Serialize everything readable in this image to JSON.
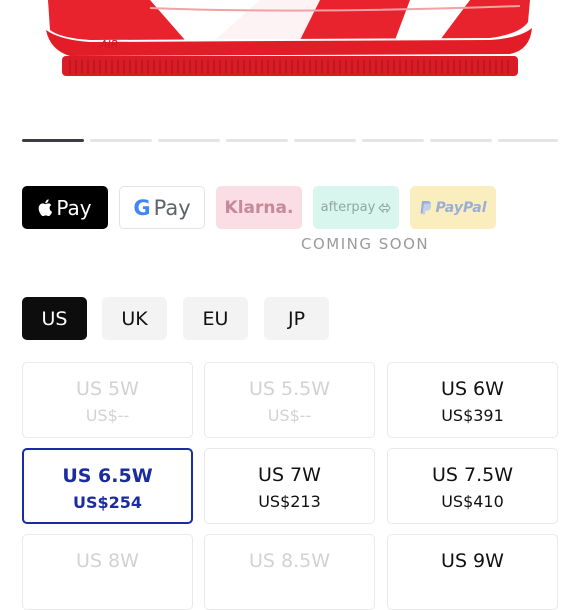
{
  "payment_methods": {
    "apple": "Pay",
    "google": "Pay",
    "klarna": "Klarna.",
    "afterpay": "afterpay",
    "paypal": "PayPal",
    "coming_soon": "COMING SOON"
  },
  "regions": [
    "US",
    "UK",
    "EU",
    "JP"
  ],
  "sizes": [
    {
      "label": "US 5W",
      "price": "US$--"
    },
    {
      "label": "US 5.5W",
      "price": "US$--"
    },
    {
      "label": "US 6W",
      "price": "US$391"
    },
    {
      "label": "US 6.5W",
      "price": "US$254"
    },
    {
      "label": "US 7W",
      "price": "US$213"
    },
    {
      "label": "US 7.5W",
      "price": "US$410"
    },
    {
      "label": "US 8W",
      "price": ""
    },
    {
      "label": "US 8.5W",
      "price": ""
    },
    {
      "label": "US 9W",
      "price": ""
    }
  ],
  "colors": {
    "selected": "#1a2ca0",
    "shoe_red": "#e8232d"
  }
}
